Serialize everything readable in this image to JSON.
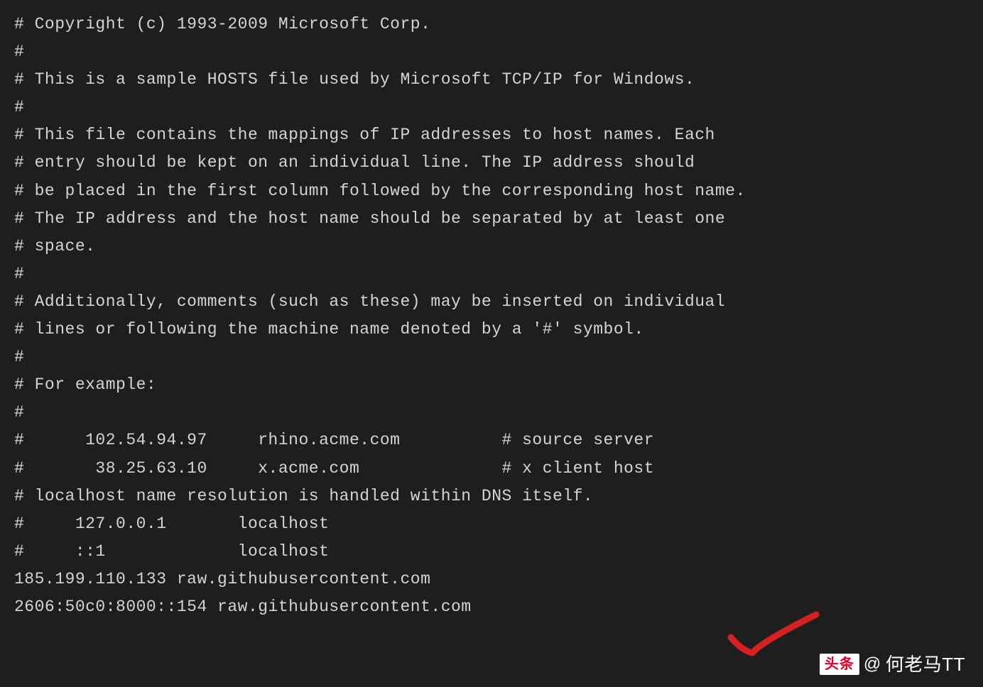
{
  "lines": {
    "l0": "# Copyright (c) 1993-2009 Microsoft Corp.",
    "l1": "#",
    "l2": "# This is a sample HOSTS file used by Microsoft TCP/IP for Windows.",
    "l3": "#",
    "l4": "# This file contains the mappings of IP addresses to host names. Each",
    "l5": "# entry should be kept on an individual line. The IP address should",
    "l6": "# be placed in the first column followed by the corresponding host name.",
    "l7": "# The IP address and the host name should be separated by at least one",
    "l8": "# space.",
    "l9": "#",
    "l10": "# Additionally, comments (such as these) may be inserted on individual",
    "l11": "# lines or following the machine name denoted by a '#' symbol.",
    "l12": "#",
    "l13": "# For example:",
    "l14": "#",
    "l15": "#      102.54.94.97     rhino.acme.com          # source server",
    "l16": "#       38.25.63.10     x.acme.com              # x client host",
    "l17": "# localhost name resolution is handled within DNS itself.",
    "l18": "#     127.0.0.1       localhost",
    "l19": "#     ::1             localhost",
    "l20": "185.199.110.133 raw.githubusercontent.com",
    "l21": "2606:50c0:8000::154 raw.githubusercontent.com"
  },
  "watermark": {
    "logo_text": "头条",
    "at": "@",
    "author": "何老马TT"
  },
  "annotation": {
    "checkmark_color": "#d42121"
  }
}
